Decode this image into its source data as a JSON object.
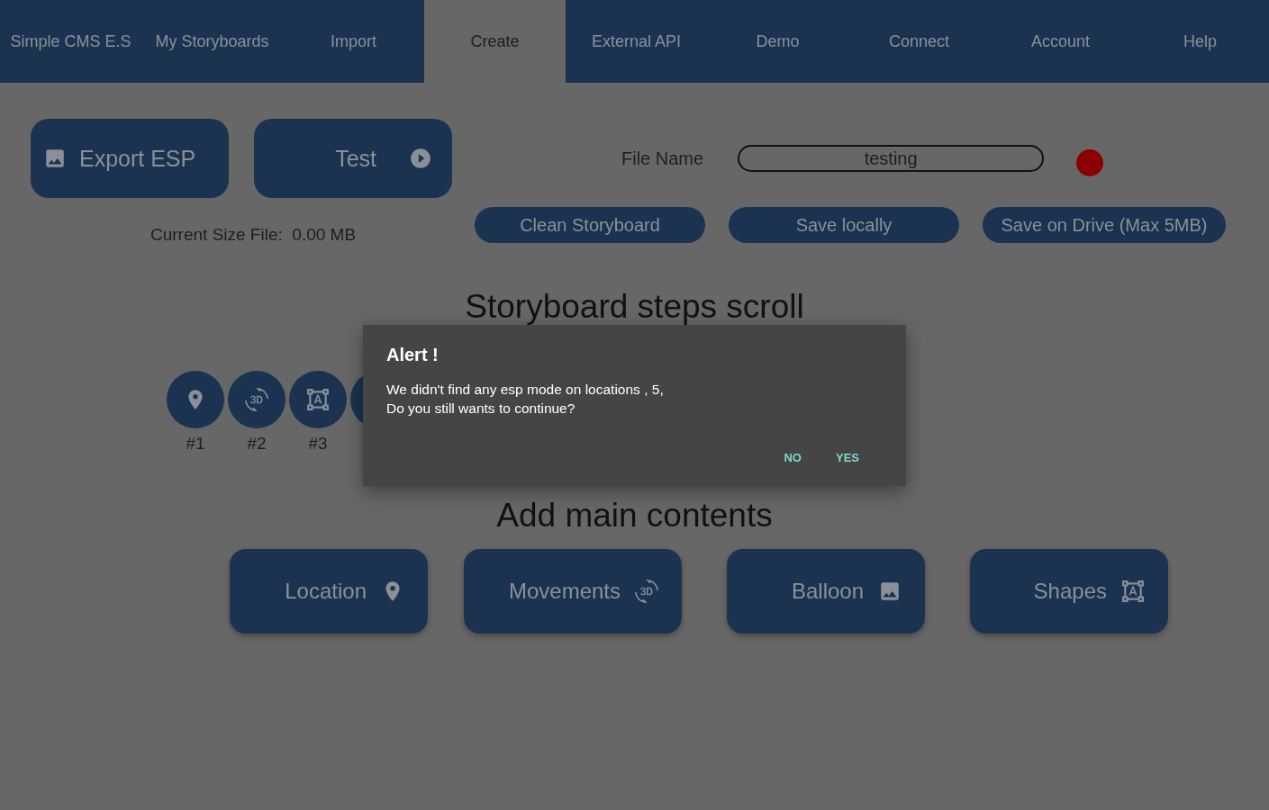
{
  "nav": {
    "tabs": [
      {
        "label": "Simple CMS E.S",
        "selected": false
      },
      {
        "label": "My Storyboards",
        "selected": false
      },
      {
        "label": "Import",
        "selected": false
      },
      {
        "label": "Create",
        "selected": true
      },
      {
        "label": "External API",
        "selected": false
      },
      {
        "label": "Demo",
        "selected": false
      },
      {
        "label": "Connect",
        "selected": false
      },
      {
        "label": "Account",
        "selected": false
      },
      {
        "label": "Help",
        "selected": false
      }
    ]
  },
  "toolbar": {
    "export_button": {
      "label": "Export ESP",
      "kind": "image"
    },
    "test_button": {
      "label": "Test",
      "kind": "play"
    },
    "file_name": {
      "label": "File Name",
      "value": "testing"
    },
    "status_dot": {
      "color": "#8b0000"
    },
    "size_info": {
      "label": "Current Size File:",
      "value": "0.00 MB"
    },
    "actions": [
      "Clean Storyboard",
      "Save locally",
      "Save on Drive (Max 5MB)"
    ]
  },
  "steps": {
    "title": "Storyboard steps scroll",
    "items": [
      {
        "kind": "location",
        "label": "#1"
      },
      {
        "kind": "movement",
        "label": "#2"
      },
      {
        "kind": "shape",
        "label": "#3"
      },
      {
        "kind": "blank"
      }
    ]
  },
  "contents": {
    "title": "Add main contents",
    "buttons": [
      {
        "label": "Location",
        "kind": "location"
      },
      {
        "label": "Movements",
        "kind": "movement"
      },
      {
        "label": "Balloon",
        "kind": "image"
      },
      {
        "label": "Shapes",
        "kind": "shape"
      }
    ]
  },
  "dialog": {
    "title": "Alert !",
    "message": [
      "We didn't find any esp mode on locations , 5,",
      "Do you still wants to continue?"
    ],
    "buttons": [
      "NO",
      "YES"
    ]
  }
}
